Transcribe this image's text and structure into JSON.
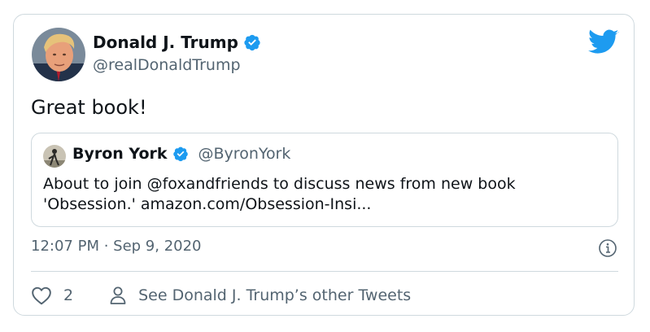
{
  "tweet": {
    "author_name": "Donald J. Trump",
    "author_handle": "@realDonaldTrump",
    "text": "Great book!",
    "timestamp": "12:07 PM · Sep 9, 2020",
    "likes": "2",
    "other_tweets_link": "See Donald J. Trump’s other Tweets"
  },
  "quoted_tweet": {
    "author_name": "Byron York",
    "author_handle": "@ByronYork",
    "text_line1": "About to join @foxandfriends to discuss news from new book",
    "text_line2": "'Obsession.' amazon.com/Obsession-Insi..."
  },
  "icons": {
    "brand": "twitter-bird-icon",
    "verified": "verified-badge-icon",
    "info": "info-icon",
    "like": "heart-icon",
    "profile": "person-icon"
  },
  "colors": {
    "twitter_blue": "#1d9bf0",
    "secondary_text": "#536471",
    "border": "#cfd9de"
  }
}
